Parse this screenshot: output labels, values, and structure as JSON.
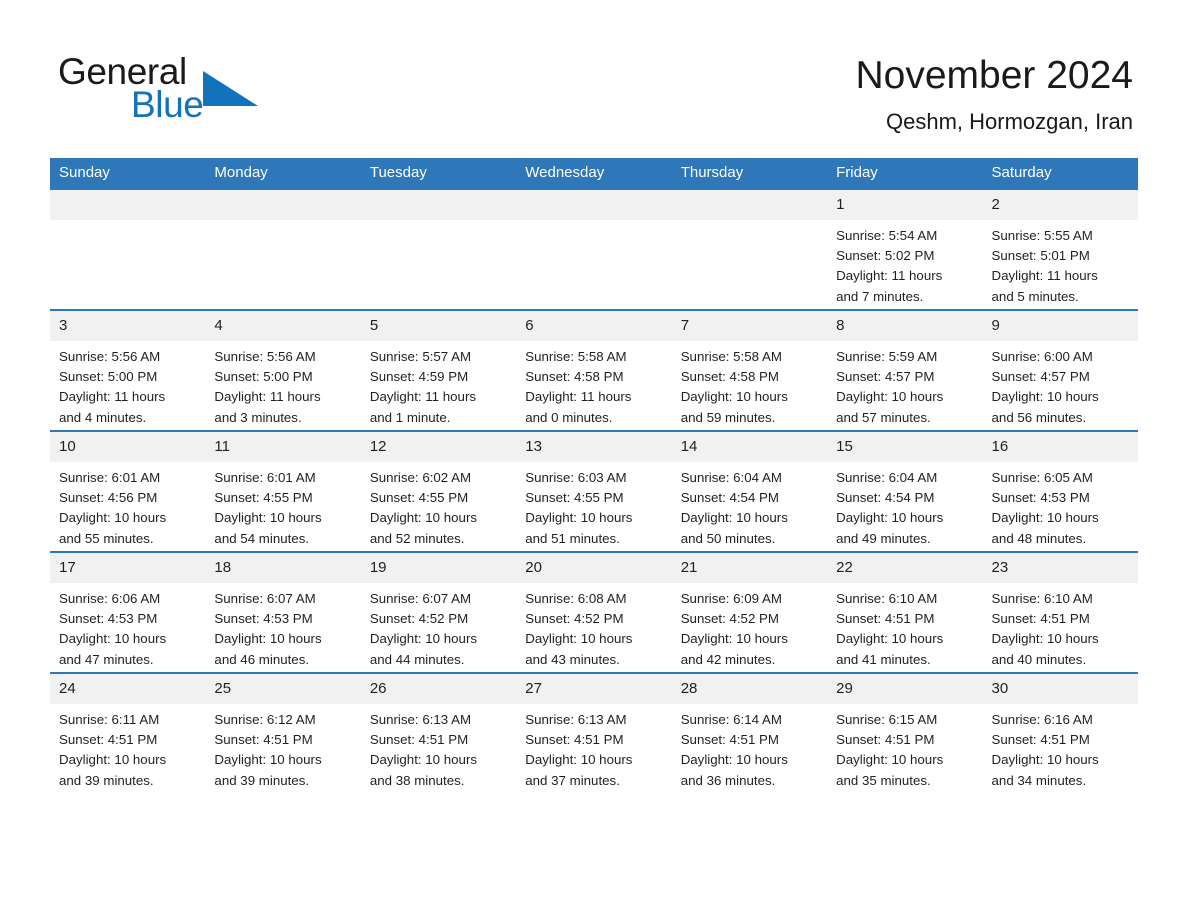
{
  "brand": {
    "name_part1": "General",
    "name_part2": "Blue",
    "flag_color": "#1273bb"
  },
  "header": {
    "title": "November 2024",
    "subtitle": "Qeshm, Hormozgan, Iran"
  },
  "theme": {
    "header_blue": "#2e77b8",
    "daynum_band": "#f1f1f1",
    "text": "#231f20"
  },
  "weekday_headers": [
    "Sunday",
    "Monday",
    "Tuesday",
    "Wednesday",
    "Thursday",
    "Friday",
    "Saturday"
  ],
  "weeks": [
    [
      {
        "day": "",
        "sunrise": "",
        "sunset": "",
        "daylight1": "",
        "daylight2": ""
      },
      {
        "day": "",
        "sunrise": "",
        "sunset": "",
        "daylight1": "",
        "daylight2": ""
      },
      {
        "day": "",
        "sunrise": "",
        "sunset": "",
        "daylight1": "",
        "daylight2": ""
      },
      {
        "day": "",
        "sunrise": "",
        "sunset": "",
        "daylight1": "",
        "daylight2": ""
      },
      {
        "day": "",
        "sunrise": "",
        "sunset": "",
        "daylight1": "",
        "daylight2": ""
      },
      {
        "day": "1",
        "sunrise": "Sunrise: 5:54 AM",
        "sunset": "Sunset: 5:02 PM",
        "daylight1": "Daylight: 11 hours",
        "daylight2": "and 7 minutes."
      },
      {
        "day": "2",
        "sunrise": "Sunrise: 5:55 AM",
        "sunset": "Sunset: 5:01 PM",
        "daylight1": "Daylight: 11 hours",
        "daylight2": "and 5 minutes."
      }
    ],
    [
      {
        "day": "3",
        "sunrise": "Sunrise: 5:56 AM",
        "sunset": "Sunset: 5:00 PM",
        "daylight1": "Daylight: 11 hours",
        "daylight2": "and 4 minutes."
      },
      {
        "day": "4",
        "sunrise": "Sunrise: 5:56 AM",
        "sunset": "Sunset: 5:00 PM",
        "daylight1": "Daylight: 11 hours",
        "daylight2": "and 3 minutes."
      },
      {
        "day": "5",
        "sunrise": "Sunrise: 5:57 AM",
        "sunset": "Sunset: 4:59 PM",
        "daylight1": "Daylight: 11 hours",
        "daylight2": "and 1 minute."
      },
      {
        "day": "6",
        "sunrise": "Sunrise: 5:58 AM",
        "sunset": "Sunset: 4:58 PM",
        "daylight1": "Daylight: 11 hours",
        "daylight2": "and 0 minutes."
      },
      {
        "day": "7",
        "sunrise": "Sunrise: 5:58 AM",
        "sunset": "Sunset: 4:58 PM",
        "daylight1": "Daylight: 10 hours",
        "daylight2": "and 59 minutes."
      },
      {
        "day": "8",
        "sunrise": "Sunrise: 5:59 AM",
        "sunset": "Sunset: 4:57 PM",
        "daylight1": "Daylight: 10 hours",
        "daylight2": "and 57 minutes."
      },
      {
        "day": "9",
        "sunrise": "Sunrise: 6:00 AM",
        "sunset": "Sunset: 4:57 PM",
        "daylight1": "Daylight: 10 hours",
        "daylight2": "and 56 minutes."
      }
    ],
    [
      {
        "day": "10",
        "sunrise": "Sunrise: 6:01 AM",
        "sunset": "Sunset: 4:56 PM",
        "daylight1": "Daylight: 10 hours",
        "daylight2": "and 55 minutes."
      },
      {
        "day": "11",
        "sunrise": "Sunrise: 6:01 AM",
        "sunset": "Sunset: 4:55 PM",
        "daylight1": "Daylight: 10 hours",
        "daylight2": "and 54 minutes."
      },
      {
        "day": "12",
        "sunrise": "Sunrise: 6:02 AM",
        "sunset": "Sunset: 4:55 PM",
        "daylight1": "Daylight: 10 hours",
        "daylight2": "and 52 minutes."
      },
      {
        "day": "13",
        "sunrise": "Sunrise: 6:03 AM",
        "sunset": "Sunset: 4:55 PM",
        "daylight1": "Daylight: 10 hours",
        "daylight2": "and 51 minutes."
      },
      {
        "day": "14",
        "sunrise": "Sunrise: 6:04 AM",
        "sunset": "Sunset: 4:54 PM",
        "daylight1": "Daylight: 10 hours",
        "daylight2": "and 50 minutes."
      },
      {
        "day": "15",
        "sunrise": "Sunrise: 6:04 AM",
        "sunset": "Sunset: 4:54 PM",
        "daylight1": "Daylight: 10 hours",
        "daylight2": "and 49 minutes."
      },
      {
        "day": "16",
        "sunrise": "Sunrise: 6:05 AM",
        "sunset": "Sunset: 4:53 PM",
        "daylight1": "Daylight: 10 hours",
        "daylight2": "and 48 minutes."
      }
    ],
    [
      {
        "day": "17",
        "sunrise": "Sunrise: 6:06 AM",
        "sunset": "Sunset: 4:53 PM",
        "daylight1": "Daylight: 10 hours",
        "daylight2": "and 47 minutes."
      },
      {
        "day": "18",
        "sunrise": "Sunrise: 6:07 AM",
        "sunset": "Sunset: 4:53 PM",
        "daylight1": "Daylight: 10 hours",
        "daylight2": "and 46 minutes."
      },
      {
        "day": "19",
        "sunrise": "Sunrise: 6:07 AM",
        "sunset": "Sunset: 4:52 PM",
        "daylight1": "Daylight: 10 hours",
        "daylight2": "and 44 minutes."
      },
      {
        "day": "20",
        "sunrise": "Sunrise: 6:08 AM",
        "sunset": "Sunset: 4:52 PM",
        "daylight1": "Daylight: 10 hours",
        "daylight2": "and 43 minutes."
      },
      {
        "day": "21",
        "sunrise": "Sunrise: 6:09 AM",
        "sunset": "Sunset: 4:52 PM",
        "daylight1": "Daylight: 10 hours",
        "daylight2": "and 42 minutes."
      },
      {
        "day": "22",
        "sunrise": "Sunrise: 6:10 AM",
        "sunset": "Sunset: 4:51 PM",
        "daylight1": "Daylight: 10 hours",
        "daylight2": "and 41 minutes."
      },
      {
        "day": "23",
        "sunrise": "Sunrise: 6:10 AM",
        "sunset": "Sunset: 4:51 PM",
        "daylight1": "Daylight: 10 hours",
        "daylight2": "and 40 minutes."
      }
    ],
    [
      {
        "day": "24",
        "sunrise": "Sunrise: 6:11 AM",
        "sunset": "Sunset: 4:51 PM",
        "daylight1": "Daylight: 10 hours",
        "daylight2": "and 39 minutes."
      },
      {
        "day": "25",
        "sunrise": "Sunrise: 6:12 AM",
        "sunset": "Sunset: 4:51 PM",
        "daylight1": "Daylight: 10 hours",
        "daylight2": "and 39 minutes."
      },
      {
        "day": "26",
        "sunrise": "Sunrise: 6:13 AM",
        "sunset": "Sunset: 4:51 PM",
        "daylight1": "Daylight: 10 hours",
        "daylight2": "and 38 minutes."
      },
      {
        "day": "27",
        "sunrise": "Sunrise: 6:13 AM",
        "sunset": "Sunset: 4:51 PM",
        "daylight1": "Daylight: 10 hours",
        "daylight2": "and 37 minutes."
      },
      {
        "day": "28",
        "sunrise": "Sunrise: 6:14 AM",
        "sunset": "Sunset: 4:51 PM",
        "daylight1": "Daylight: 10 hours",
        "daylight2": "and 36 minutes."
      },
      {
        "day": "29",
        "sunrise": "Sunrise: 6:15 AM",
        "sunset": "Sunset: 4:51 PM",
        "daylight1": "Daylight: 10 hours",
        "daylight2": "and 35 minutes."
      },
      {
        "day": "30",
        "sunrise": "Sunrise: 6:16 AM",
        "sunset": "Sunset: 4:51 PM",
        "daylight1": "Daylight: 10 hours",
        "daylight2": "and 34 minutes."
      }
    ]
  ]
}
